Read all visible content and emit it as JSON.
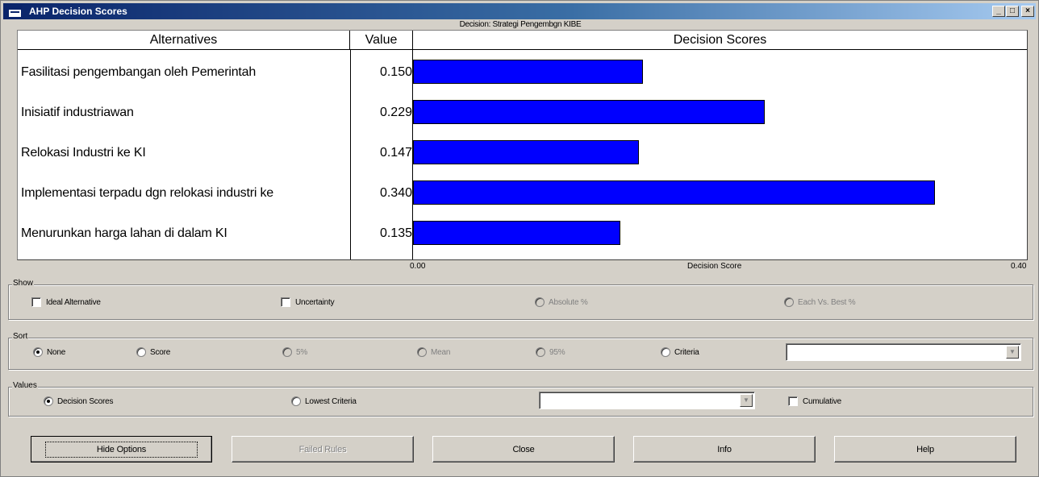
{
  "window": {
    "title": "AHP Decision Scores",
    "minimize": "_",
    "maximize": "□",
    "close": "×"
  },
  "decision_label": "Decision: Strategi Pengembgn KIBE",
  "table": {
    "col_alternatives": "Alternatives",
    "col_value": "Value",
    "col_scores": "Decision Scores",
    "rows": [
      {
        "name": "Fasilitasi pengembangan oleh Pemerintah",
        "value": "0.150"
      },
      {
        "name": "Inisiatif industriawan",
        "value": "0.229"
      },
      {
        "name": "Relokasi Industri ke KI",
        "value": "0.147"
      },
      {
        "name": "Implementasi terpadu dgn relokasi industri ke",
        "value": "0.340"
      },
      {
        "name": "Menurunkan harga lahan di dalam KI",
        "value": "0.135"
      }
    ],
    "bar_color": "#0000FF"
  },
  "axis": {
    "min_label": "0.00",
    "title": "Decision Score",
    "max_label": "0.40",
    "range": [
      0,
      0.4
    ]
  },
  "show": {
    "title": "Show",
    "ideal_alternative": "Ideal Alternative",
    "uncertainty": "Uncertainty",
    "absolute": "Absolute %",
    "each_vs_best": "Each Vs. Best %"
  },
  "sort": {
    "title": "Sort",
    "none": "None",
    "score": "Score",
    "p5": "5%",
    "mean": "Mean",
    "p95": "95%",
    "criteria": "Criteria",
    "combo_value": ""
  },
  "values": {
    "title": "Values",
    "decision_scores": "Decision Scores",
    "lowest_criteria": "Lowest Criteria",
    "combo_value": "",
    "cumulative": "Cumulative"
  },
  "buttons": {
    "hide_options": "Hide Options",
    "failed_rules": "Failed Rules",
    "close": "Close",
    "info": "Info",
    "help": "Help"
  }
}
